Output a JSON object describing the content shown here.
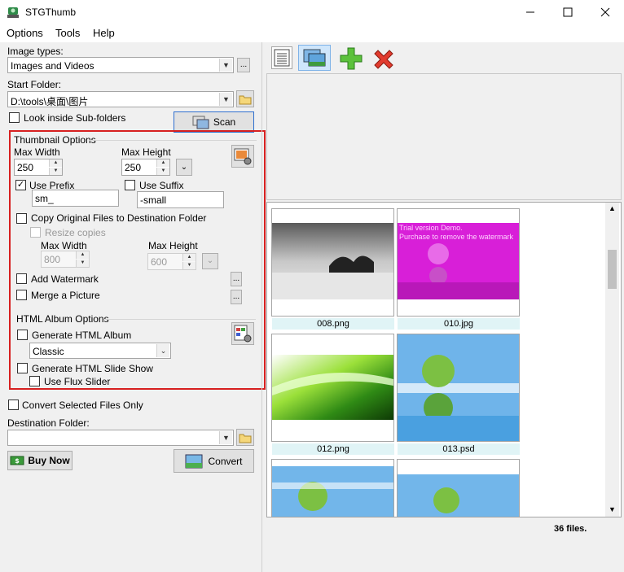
{
  "window": {
    "title": "STGThumb"
  },
  "menu": [
    "Options",
    "Tools",
    "Help"
  ],
  "image_types": {
    "label": "Image types:",
    "value": "Images and Videos",
    "more": "..."
  },
  "start_folder": {
    "label": "Start Folder:",
    "value": "D:\\tools\\桌面\\图片"
  },
  "look_inside_sub": {
    "label": "Look inside Sub-folders",
    "checked": false
  },
  "scan_label": "Scan",
  "thumbnail_options": {
    "group_label": "Thumbnail Options",
    "max_width_label": "Max Width",
    "max_width": "250",
    "max_height_label": "Max Height",
    "max_height": "250",
    "use_prefix_label": "Use Prefix",
    "use_prefix_checked": true,
    "prefix": "sm_",
    "use_suffix_label": "Use Suffix",
    "use_suffix_checked": false,
    "suffix": "-small",
    "copy_original_label": "Copy Original Files to Destination Folder",
    "resize_copies_label": "Resize copies",
    "copy_max_width_label": "Max Width",
    "copy_max_width": "800",
    "copy_max_height_label": "Max Height",
    "copy_max_height": "600",
    "add_watermark_label": "Add Watermark",
    "merge_picture_label": "Merge a Picture",
    "dots": "..."
  },
  "html_album": {
    "group_label": "HTML Album Options",
    "generate_album_label": "Generate HTML Album",
    "template": "Classic",
    "generate_slideshow_label": "Generate HTML Slide Show",
    "use_flux_label": "Use Flux Slider"
  },
  "convert_selected_label": "Convert Selected Files Only",
  "destination_folder": {
    "label": "Destination Folder:",
    "value": ""
  },
  "buy_now_label": "Buy Now",
  "convert_label": "Convert",
  "thumbnails": [
    {
      "name": "008.png"
    },
    {
      "name": "010.jpg",
      "overlay_1": "Trial version Demo.",
      "overlay_2": "Purchase to remove the watermark"
    },
    {
      "name": "012.png"
    },
    {
      "name": "013.psd"
    },
    {
      "name": ""
    },
    {
      "name": ""
    }
  ],
  "status": {
    "file_count": "36 files."
  },
  "colors": {
    "accent_red": "#d72020",
    "label_bg": "#e0f4f6",
    "green": "#3cb034"
  }
}
